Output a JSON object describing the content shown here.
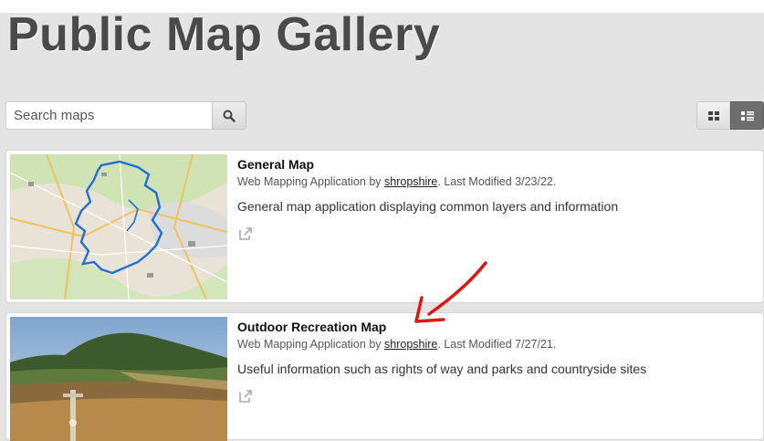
{
  "header": {
    "title": "Public Map Gallery"
  },
  "search": {
    "placeholder": "Search maps",
    "value": ""
  },
  "view_toggle": {
    "active": "list"
  },
  "items": [
    {
      "title": "General Map",
      "type": "Web Mapping Application",
      "by": "by",
      "owner": "shropshire",
      "modified": ". Last Modified 3/23/22.",
      "description": "General map application displaying common layers and information"
    },
    {
      "title": "Outdoor Recreation Map",
      "type": "Web Mapping Application",
      "by": "by",
      "owner": "shropshire",
      "modified": ". Last Modified 7/27/21.",
      "description": "Useful information such as rights of way and parks and countryside sites"
    }
  ],
  "icons": {
    "search": "search-icon",
    "grid_view": "grid-view-icon",
    "list_view": "list-view-icon",
    "open": "external-link-icon"
  },
  "colors": {
    "annotation_arrow": "#e01515",
    "boundary_line": "#1f6fd6",
    "active_toggle": "#6e6e6e"
  }
}
